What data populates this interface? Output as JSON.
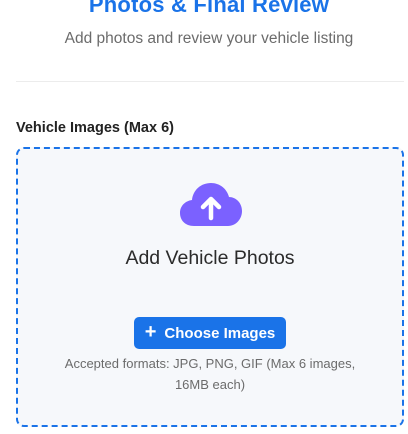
{
  "header": {
    "title": "Photos & Final Review",
    "subtitle": "Add photos and review your vehicle listing"
  },
  "images_field": {
    "label": "Vehicle Images (Max 6)"
  },
  "dropzone": {
    "icon": "cloud-upload-icon",
    "heading": "Add Vehicle Photos",
    "button_icon": "plus-icon",
    "button_label": "Choose Images",
    "formats_text": "Accepted formats: JPG, PNG, GIF (Max 6 images, 16MB each)"
  },
  "colors": {
    "accent": "#1a73e8",
    "icon_purple": "#7b61ff",
    "dropzone_bg": "#f6f8fb"
  }
}
